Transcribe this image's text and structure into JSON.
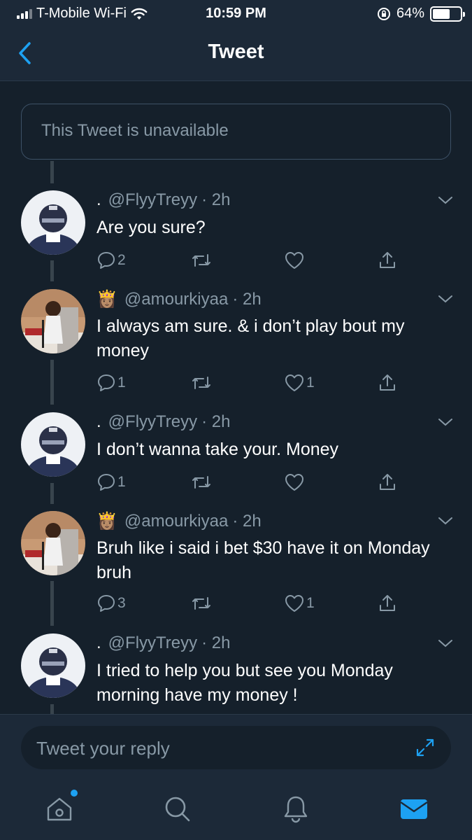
{
  "status_bar": {
    "carrier": "T-Mobile Wi-Fi",
    "time": "10:59 PM",
    "battery_percent": "64%",
    "battery_level": 0.64
  },
  "nav": {
    "title": "Tweet"
  },
  "unavailable_text": "This Tweet is unavailable",
  "tweets": [
    {
      "name": ".",
      "handle": "@FlyyTreyy",
      "time": "· 2h",
      "text": "Are you sure?",
      "replies": "2",
      "retweets": "",
      "likes": ""
    },
    {
      "name": "👸🏽",
      "handle": "@amourkiyaa",
      "time": "· 2h",
      "text": "I always am sure. & i don’t play bout my money",
      "replies": "1",
      "retweets": "",
      "likes": "1"
    },
    {
      "name": ".",
      "handle": "@FlyyTreyy",
      "time": "· 2h",
      "text": "I don’t wanna take your. Money",
      "replies": "1",
      "retweets": "",
      "likes": ""
    },
    {
      "name": "👸🏽",
      "handle": "@amourkiyaa",
      "time": "· 2h",
      "text": "Bruh like i said i bet $30 have it on Monday bruh",
      "replies": "3",
      "retweets": "",
      "likes": "1"
    },
    {
      "name": ".",
      "handle": "@FlyyTreyy",
      "time": "· 2h",
      "text": "I tried to help you but see you Monday morning have my money !",
      "replies": "",
      "retweets": "",
      "likes": ""
    }
  ],
  "compose": {
    "placeholder": "Tweet your reply"
  },
  "tabs": [
    {
      "icon": "home-icon",
      "has_notification_dot": true
    },
    {
      "icon": "search-icon"
    },
    {
      "icon": "bell-icon"
    },
    {
      "icon": "mail-icon",
      "active": true
    }
  ],
  "colors": {
    "background": "#15202b",
    "bar": "#1c2938",
    "accent": "#1da1f2",
    "muted": "#8899a6"
  }
}
